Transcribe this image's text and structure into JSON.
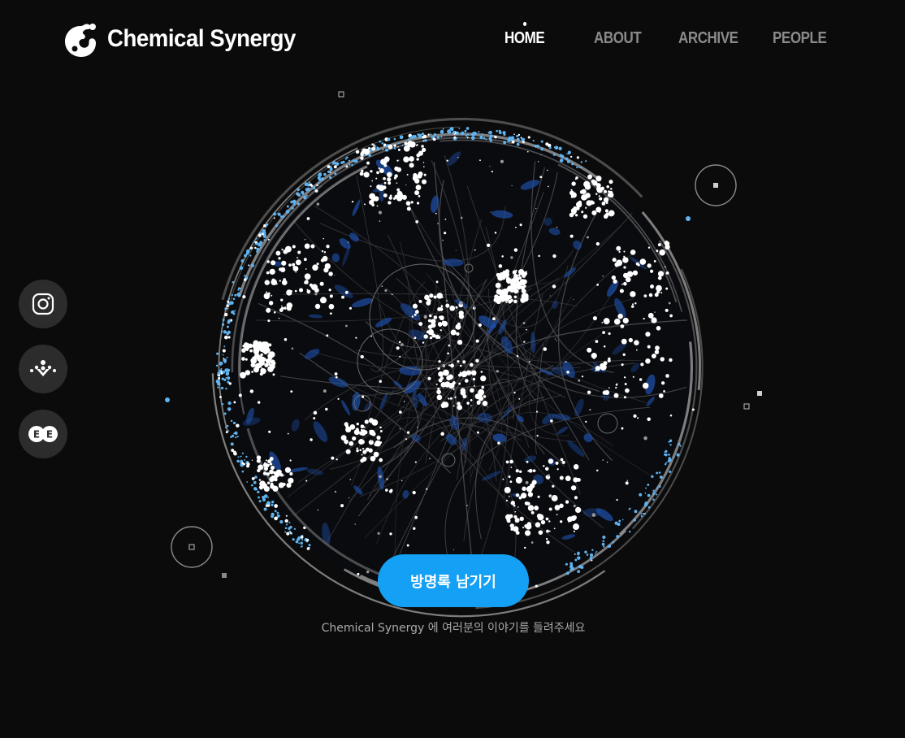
{
  "brand": {
    "name": "Chemical Synergy",
    "logo_icon": "splash-logo-icon"
  },
  "nav": {
    "items": [
      {
        "label": "HOME",
        "active": true
      },
      {
        "label": "ABOUT",
        "active": false
      },
      {
        "label": "ARCHIVE",
        "active": false
      },
      {
        "label": "PEOPLE",
        "active": false
      }
    ]
  },
  "social": [
    {
      "icon": "instagram-icon"
    },
    {
      "icon": "network-icon"
    },
    {
      "icon": "ee-icon",
      "label": "E E"
    }
  ],
  "hero": {
    "cta_label": "방명록 남기기",
    "caption": "Chemical Synergy 에 여러분의 이야기를 들려주세요"
  },
  "colors": {
    "background": "#0b0b0b",
    "accent": "#14a0f5",
    "nav_inactive": "#8a8a8a",
    "social_bg": "#2c2c2c"
  }
}
